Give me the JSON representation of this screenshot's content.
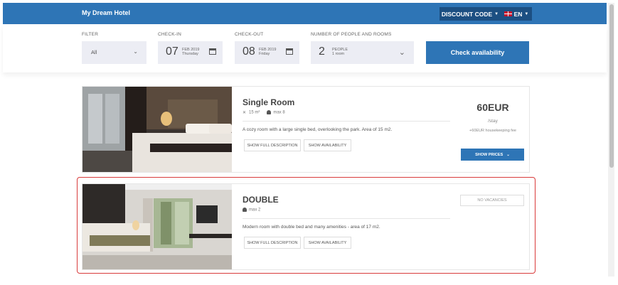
{
  "header": {
    "brand": "My Dream Hotel",
    "discount_label": "DISCOUNT CODE",
    "language_label": "EN",
    "bar_color": "#2e75b6"
  },
  "filters": {
    "filter": {
      "label": "FILTER",
      "value": "All"
    },
    "checkin": {
      "label": "CHECK-IN",
      "day": "07",
      "month_year": "FEB 2019",
      "weekday": "Thursday"
    },
    "checkout": {
      "label": "CHECK-OUT",
      "day": "08",
      "month_year": "FEB 2019",
      "weekday": "Friday"
    },
    "people": {
      "label": "NUMBER OF PEOPLE AND ROOMS",
      "count": "2",
      "unit": "PEOPLE",
      "rooms": "1 room"
    },
    "check_button": "Check availability"
  },
  "rooms": [
    {
      "title": "Single Room",
      "size": "15 m²",
      "max": "max 8",
      "description": "A cozy room with a large single bed, overlooking the park. Area of 15 m2.",
      "btn_full": "SHOW FULL DESCRIPTION",
      "btn_avail": "SHOW AVAILABILITY",
      "price": "60EUR",
      "per": "/stay",
      "fee": "+60EUR housekeeping fee",
      "show_prices": "SHOW PRICES"
    },
    {
      "title": "DOUBLE",
      "max": "max 2",
      "description": "Modern room with double bed and many amenities - area of 17 m2.",
      "btn_full": "SHOW FULL DESCRIPTION",
      "btn_avail": "SHOW AVAILABILITY",
      "status": "NO VACANCIES"
    }
  ]
}
